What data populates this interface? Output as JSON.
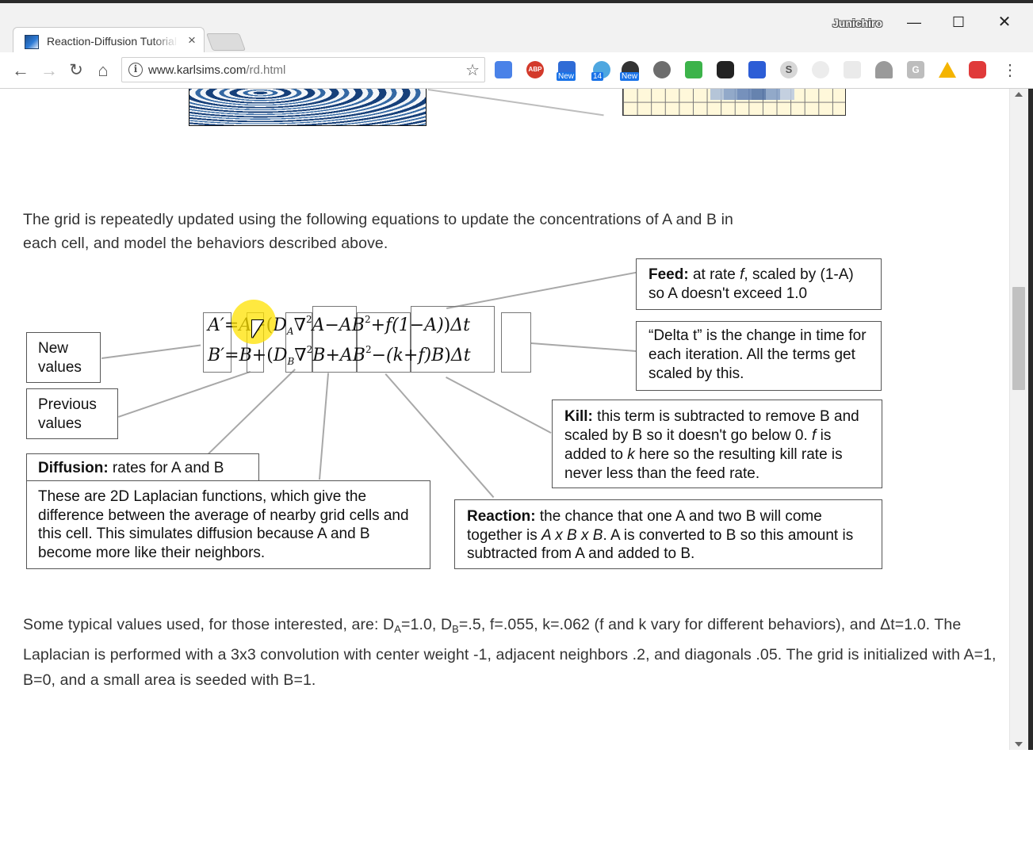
{
  "browser": {
    "tab": {
      "title": "Reaction-Diffusion Tutorial",
      "close": "×"
    },
    "profile_name": "Junichiro",
    "window_buttons": {
      "minimize": "—",
      "maximize": "☐",
      "close": "✕"
    },
    "nav": {
      "back": "←",
      "forward": "→",
      "reload": "↻",
      "home": "⌂",
      "menu": "⋮",
      "bookmark": "☆"
    },
    "url": {
      "host": "www.karlsims.com",
      "path": "/rd.html"
    },
    "extensions": [
      {
        "name": "translate-extension-icon"
      },
      {
        "name": "adblock-plus-icon",
        "label": "ABP"
      },
      {
        "name": "feedly-icon",
        "badge": "New"
      },
      {
        "name": "extension-icon",
        "badge": "14"
      },
      {
        "name": "extension-icon",
        "badge": "New"
      },
      {
        "name": "extension-icon"
      },
      {
        "name": "extension-icon"
      },
      {
        "name": "extension-icon"
      },
      {
        "name": "extension-icon"
      },
      {
        "name": "extension-icon",
        "label": "S"
      },
      {
        "name": "extension-icon"
      },
      {
        "name": "extension-icon"
      },
      {
        "name": "extension-icon"
      },
      {
        "name": "extension-icon",
        "label": "G"
      },
      {
        "name": "google-drive-icon"
      },
      {
        "name": "extension-icon"
      }
    ]
  },
  "page": {
    "intro_para": "The grid is repeatedly updated using the following equations to update the concentrations of A and B in each cell, and model the behaviors described above.",
    "equation": {
      "line1": {
        "lhs": "A′",
        "eq": "=",
        "prev": "A",
        "op1": "+(",
        "diff_coef": "D",
        "diff_sub": "A",
        "lap": "∇",
        "lap_sup": "2",
        "lap_var": "A",
        "react": "−AB",
        "react_sup": "2",
        "feed": "+f(1−A)",
        "close": ")",
        "dt": "Δt"
      },
      "line2": {
        "lhs": "B′",
        "eq": "=",
        "prev": "B",
        "op1": "+(",
        "diff_coef": "D",
        "diff_sub": "B",
        "lap": "∇",
        "lap_sup": "2",
        "lap_var": "B",
        "react": "+AB",
        "react_sup": "2",
        "feed": "−(k+f)B",
        "close": ")",
        "dt": "Δt"
      }
    },
    "callouts": {
      "new_values": "New values",
      "previous_values": "Previous values",
      "diffusion_title": "Diffusion:",
      "diffusion_title_rest": " rates for A and B",
      "diffusion_body": "These are 2D Laplacian functions, which give the difference between the average of nearby grid cells and this cell. This simulates diffusion because A and B become more like their neighbors.",
      "feed_title": "Feed:",
      "feed_rest_1": " at rate ",
      "feed_f": "f",
      "feed_rest_2": ", scaled by (1-A) so A doesn't exceed 1.0",
      "delta_t": "“Delta t” is the change in time for each iteration. All the terms get scaled by this.",
      "kill_title": "Kill:",
      "kill_rest_1": " this term is subtracted to remove B and scaled by B so it doesn't go below 0. ",
      "kill_f": "f",
      "kill_rest_2": " is added to ",
      "kill_k": "k",
      "kill_rest_3": " here so the resulting kill rate is never less than the feed rate.",
      "reaction_title": "Reaction:",
      "reaction_rest_1": " the chance that one A and two B will come together is ",
      "reaction_formula": "A x B x B",
      "reaction_rest_2": ".  A is converted to B so this amount is subtracted from A and added to B."
    },
    "values_para": {
      "p1": "Some typical values used, for those interested, are: D",
      "sub_a": "A",
      "p2": "=1.0, D",
      "sub_b": "B",
      "p3": "=.5, f=.055, k=.062 (f and k vary for different behaviors), and Δt=1.0. The Laplacian is performed with a 3x3 convolution with center weight -1, adjacent neighbors .2, and diagonals .05. The grid is initialized with A=1, B=0, and a small area is seeded with B=1."
    }
  }
}
